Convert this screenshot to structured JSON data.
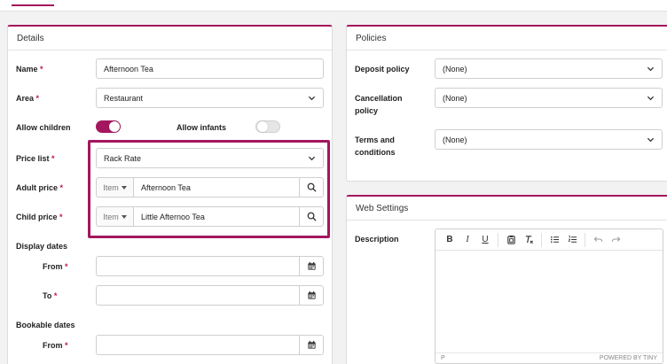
{
  "details": {
    "title": "Details",
    "name_label": "Name",
    "name_value": "Afternoon Tea",
    "area_label": "Area",
    "area_value": "Restaurant",
    "allow_children_label": "Allow children",
    "allow_children": true,
    "allow_infants_label": "Allow infants",
    "allow_infants": false,
    "price_list_label": "Price list",
    "price_list_value": "Rack Rate",
    "adult_price_label": "Adult price",
    "adult_price_type": "Item",
    "adult_price_value": "Afternoon Tea",
    "child_price_label": "Child price",
    "child_price_type": "Item",
    "child_price_value": "Little Afternoo Tea",
    "display_dates_label": "Display dates",
    "display_from_label": "From",
    "display_to_label": "To",
    "bookable_dates_label": "Bookable dates",
    "bookable_from_label": "From",
    "required_marker": "*"
  },
  "policies": {
    "title": "Policies",
    "deposit_label": "Deposit policy",
    "deposit_value": "(None)",
    "cancellation_label_line1": "Cancellation",
    "cancellation_label_line2": "policy",
    "cancellation_value": "(None)",
    "terms_label_line1": "Terms and",
    "terms_label_line2": "conditions",
    "terms_value": "(None)"
  },
  "web_settings": {
    "title": "Web Settings",
    "description_label": "Description",
    "editor_toolbar": {
      "bold": "B",
      "italic": "I",
      "underline": "U"
    },
    "editor_path": "P",
    "powered_by": "POWERED BY TINY"
  },
  "colors": {
    "accent": "#a4165e",
    "required": "#c0174e"
  }
}
